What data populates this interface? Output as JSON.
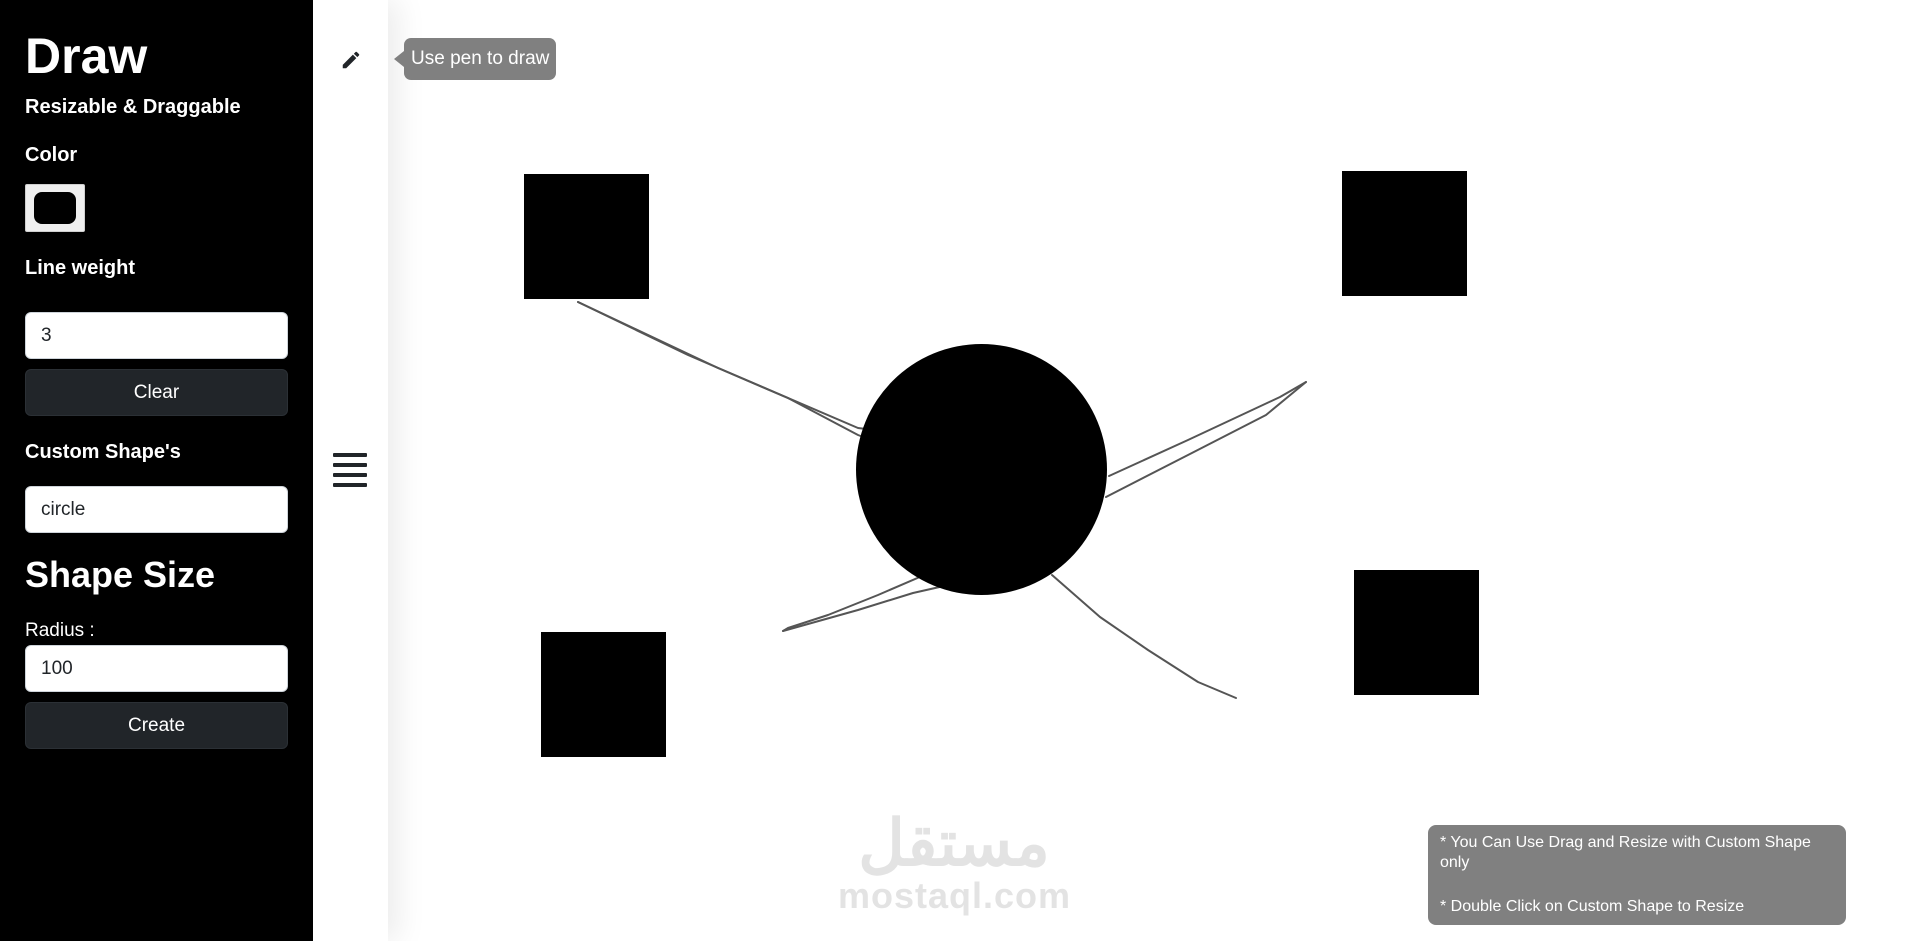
{
  "sidebar": {
    "title": "Draw",
    "subtitle": "Resizable & Draggable",
    "color_label": "Color",
    "color_value": "#000000",
    "line_weight_label": "Line weight",
    "line_weight_value": "3",
    "clear_label": "Clear",
    "custom_shape_label": "Custom Shape's",
    "custom_shape_value": "circle",
    "shape_size_heading": "Shape Size",
    "radius_label": "Radius :",
    "radius_value": "100",
    "create_label": "Create"
  },
  "toolbar": {
    "pen_icon": "pencil-icon",
    "menu_icon": "hamburger-menu-icon",
    "pen_tooltip": "Use pen to draw"
  },
  "canvas": {
    "shapes": [
      {
        "type": "square",
        "name": "square-top-left"
      },
      {
        "type": "square",
        "name": "square-top-right"
      },
      {
        "type": "square",
        "name": "square-bottom-left"
      },
      {
        "type": "square",
        "name": "square-bottom-right"
      },
      {
        "type": "circle",
        "name": "center-circle"
      }
    ],
    "fill_color": "#000000",
    "stroke_color": "#555555"
  },
  "watermark": {
    "arabic": "مستقل",
    "latin": "mostaql.com"
  },
  "info": {
    "line1": "* You Can Use Drag and Resize with Custom Shape only",
    "line2": "* Double Click on Custom Shape to Resize"
  }
}
